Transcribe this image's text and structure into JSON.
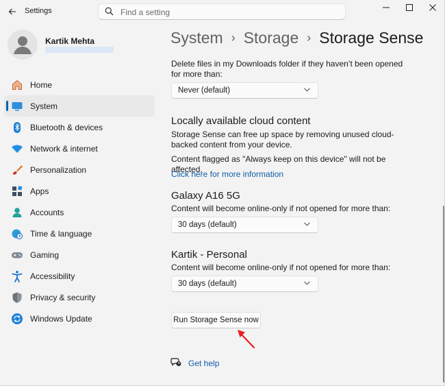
{
  "window": {
    "title": "Settings",
    "controls": [
      "minimize",
      "maximize",
      "close"
    ]
  },
  "search": {
    "placeholder": "Find a setting",
    "value": ""
  },
  "user": {
    "name": "Kartik Mehta"
  },
  "sidebar": {
    "items": [
      {
        "label": "Home",
        "icon": "home-icon",
        "active": false
      },
      {
        "label": "System",
        "icon": "system-icon",
        "active": true
      },
      {
        "label": "Bluetooth & devices",
        "icon": "bluetooth-icon",
        "active": false
      },
      {
        "label": "Network & internet",
        "icon": "wifi-icon",
        "active": false
      },
      {
        "label": "Personalization",
        "icon": "brush-icon",
        "active": false
      },
      {
        "label": "Apps",
        "icon": "apps-icon",
        "active": false
      },
      {
        "label": "Accounts",
        "icon": "accounts-icon",
        "active": false
      },
      {
        "label": "Time & language",
        "icon": "globe-clock-icon",
        "active": false
      },
      {
        "label": "Gaming",
        "icon": "gamepad-icon",
        "active": false
      },
      {
        "label": "Accessibility",
        "icon": "accessibility-icon",
        "active": false
      },
      {
        "label": "Privacy & security",
        "icon": "shield-icon",
        "active": false
      },
      {
        "label": "Windows Update",
        "icon": "update-icon",
        "active": false
      }
    ]
  },
  "breadcrumb": {
    "level1": "System",
    "level2": "Storage",
    "current": "Storage Sense"
  },
  "content": {
    "downloads_text": "Delete files in my Downloads folder if they haven’t been opened for more than:",
    "downloads_dropdown": "Never (default)",
    "cloud_heading": "Locally available cloud content",
    "cloud_desc": "Storage Sense can free up space by removing unused cloud-backed content from your device.",
    "cloud_note": "Content flagged as \"Always keep on this device\" will not be affected.",
    "cloud_link": "Click here for more information",
    "galaxy_heading": "Galaxy A16 5G",
    "galaxy_desc": "Content will become online-only if not opened for more than:",
    "galaxy_dropdown": "30 days (default)",
    "personal_heading": "Kartik - Personal",
    "personal_desc": "Content will become online-only if not opened for more than:",
    "personal_dropdown": "30 days (default)",
    "run_button": "Run Storage Sense now",
    "help_link": "Get help"
  },
  "colors": {
    "accent": "#005fb8",
    "link": "#0e5ea8",
    "annotation_arrow": "#e81f1f"
  }
}
